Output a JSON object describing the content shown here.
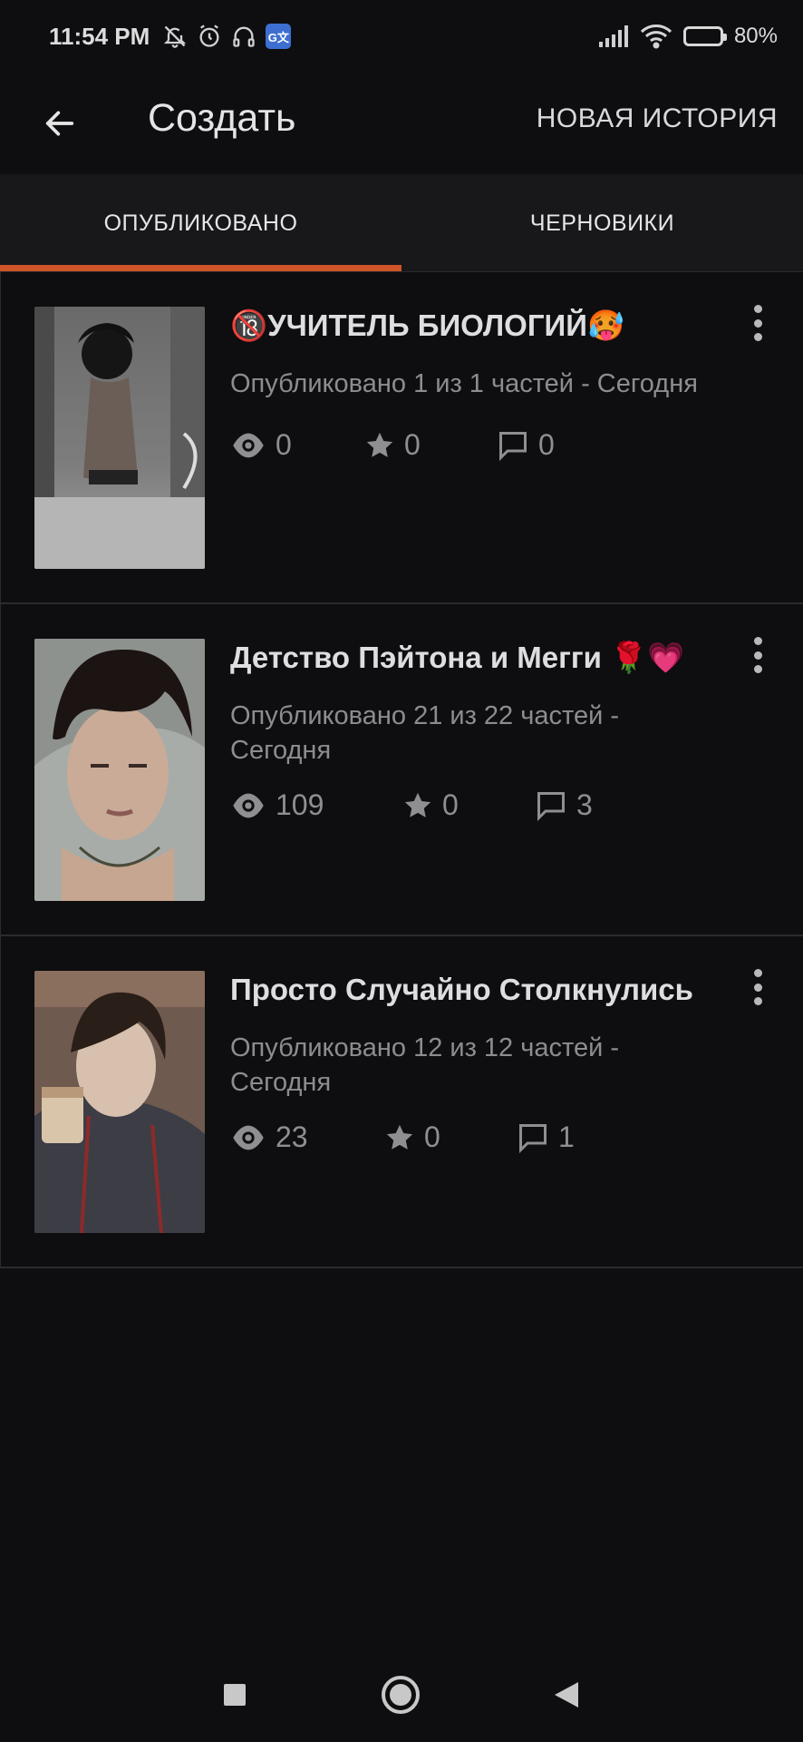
{
  "status_bar": {
    "time": "11:54 PM",
    "battery": "80%",
    "battery_level": 0.8,
    "icons": [
      "mute-bell-icon",
      "alarm-icon",
      "headphones-icon",
      "google-translate-icon",
      "signal-icon",
      "wifi-icon",
      "battery-icon"
    ],
    "translate_glyph": "G文"
  },
  "app_bar": {
    "title": "Создать",
    "action_label": "НОВАЯ ИСТОРИЯ",
    "back_icon": "arrow-left-icon"
  },
  "tabs": [
    {
      "label": "ОПУБЛИКОВАНО",
      "selected": true
    },
    {
      "label": "ЧЕРНОВИКИ",
      "selected": false
    }
  ],
  "accent_color": "#cf5427",
  "stories": [
    {
      "title": "🔞УЧИТЕЛЬ БИОЛОГИЙ🥵",
      "subtitle": "Опубликовано 1 из 1 частей - Сегодня",
      "views": "0",
      "votes": "0",
      "comments": "0"
    },
    {
      "title": "Детство Пэйтона и Мегги 🌹💗",
      "subtitle": "Опубликовано 21 из 22 частей - Сегодня",
      "views": "109",
      "votes": "0",
      "comments": "3"
    },
    {
      "title": "Просто Случайно Столкнулись",
      "subtitle": "Опубликовано 12 из 12 частей - Сегодня",
      "views": "23",
      "votes": "0",
      "comments": "1"
    }
  ],
  "nav_bar": {
    "icons": [
      "recents-square-icon",
      "home-circle-icon",
      "back-triangle-icon"
    ]
  }
}
